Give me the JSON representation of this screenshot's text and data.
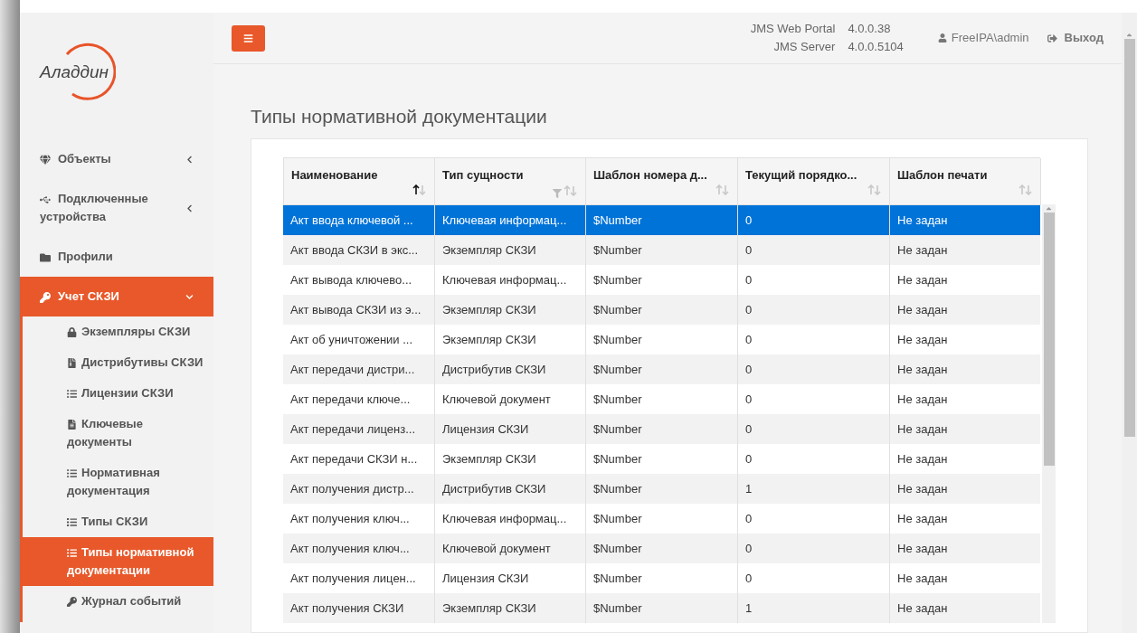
{
  "logo": {
    "text": "Аладдин"
  },
  "header": {
    "versions": [
      {
        "name": "JMS Web Portal",
        "value": "4.0.0.38"
      },
      {
        "name": "JMS Server",
        "value": "4.0.0.5104"
      }
    ],
    "user": "FreeIPA\\admin",
    "logout": "Выход"
  },
  "sidebar": {
    "items": [
      {
        "kind": "group",
        "label": "Объекты",
        "expanded": false
      },
      {
        "kind": "group",
        "label": "Подключенные устройства",
        "expanded": false
      },
      {
        "kind": "link",
        "label": "Профили",
        "selected": false
      },
      {
        "kind": "group",
        "label": "Учет СКЗИ",
        "expanded": true,
        "children": [
          {
            "label": "Экземпляры СКЗИ",
            "selected": false
          },
          {
            "label": "Дистрибутивы СКЗИ",
            "selected": false
          },
          {
            "label": "Лицензии СКЗИ",
            "selected": false
          },
          {
            "label": "Ключевые документы",
            "selected": false
          },
          {
            "label": "Нормативная документация",
            "selected": false
          },
          {
            "label": "Типы СКЗИ",
            "selected": false
          },
          {
            "label": "Типы нормативной документации",
            "selected": true
          },
          {
            "label": "Журнал событий",
            "selected": false
          }
        ]
      }
    ]
  },
  "page": {
    "title": "Типы нормативной документации"
  },
  "table": {
    "columns": [
      {
        "label": "Наименование",
        "sorted": true,
        "filter": false
      },
      {
        "label": "Тип сущности",
        "sorted": false,
        "filter": true
      },
      {
        "label": "Шаблон номера д...",
        "sorted": false,
        "filter": false
      },
      {
        "label": "Текущий порядко...",
        "sorted": false,
        "filter": false
      },
      {
        "label": "Шаблон печати",
        "sorted": false,
        "filter": false
      }
    ],
    "rows": [
      {
        "selected": true,
        "cells": [
          "Акт ввода ключевой ...",
          "Ключевая информац...",
          "$Number",
          "0",
          "Не задан"
        ]
      },
      {
        "selected": false,
        "cells": [
          "Акт ввода СКЗИ в экс...",
          "Экземпляр СКЗИ",
          "$Number",
          "0",
          "Не задан"
        ]
      },
      {
        "selected": false,
        "cells": [
          "Акт вывода ключево...",
          "Ключевая информац...",
          "$Number",
          "0",
          "Не задан"
        ]
      },
      {
        "selected": false,
        "cells": [
          "Акт вывода СКЗИ из э...",
          "Экземпляр СКЗИ",
          "$Number",
          "0",
          "Не задан"
        ]
      },
      {
        "selected": false,
        "cells": [
          "Акт об уничтожении ...",
          "Экземпляр СКЗИ",
          "$Number",
          "0",
          "Не задан"
        ]
      },
      {
        "selected": false,
        "cells": [
          "Акт передачи дистри...",
          "Дистрибутив СКЗИ",
          "$Number",
          "0",
          "Не задан"
        ]
      },
      {
        "selected": false,
        "cells": [
          "Акт передачи ключе...",
          "Ключевой документ",
          "$Number",
          "0",
          "Не задан"
        ]
      },
      {
        "selected": false,
        "cells": [
          "Акт передачи лиценз...",
          "Лицензия СКЗИ",
          "$Number",
          "0",
          "Не задан"
        ]
      },
      {
        "selected": false,
        "cells": [
          "Акт передачи СКЗИ н...",
          "Экземпляр СКЗИ",
          "$Number",
          "0",
          "Не задан"
        ]
      },
      {
        "selected": false,
        "cells": [
          "Акт получения дистр...",
          "Дистрибутив СКЗИ",
          "$Number",
          "1",
          "Не задан"
        ]
      },
      {
        "selected": false,
        "cells": [
          "Акт получения ключ...",
          "Ключевая информац...",
          "$Number",
          "0",
          "Не задан"
        ]
      },
      {
        "selected": false,
        "cells": [
          "Акт получения ключ...",
          "Ключевой документ",
          "$Number",
          "0",
          "Не задан"
        ]
      },
      {
        "selected": false,
        "cells": [
          "Акт получения лицен...",
          "Лицензия СКЗИ",
          "$Number",
          "0",
          "Не задан"
        ]
      },
      {
        "selected": false,
        "cells": [
          "Акт получения СКЗИ",
          "Экземпляр СКЗИ",
          "$Number",
          "1",
          "Не задан"
        ]
      }
    ]
  }
}
